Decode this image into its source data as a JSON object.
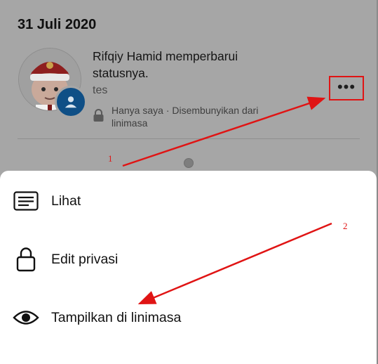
{
  "date_heading": "31 Juli 2020",
  "post": {
    "title": "Rifqiy Hamid memperbarui statusnya.",
    "text": "tes",
    "privacy": "Hanya saya · Disembunyikan dari linimasa"
  },
  "icons": {
    "more": "more-horizontal-icon",
    "privacy": "lock-icon",
    "profile": "person-icon",
    "view": "document-lines-icon",
    "edit_privacy": "lock-icon",
    "show": "eye-icon"
  },
  "more_dots": "•••",
  "sheet": {
    "items": [
      {
        "label": "Lihat"
      },
      {
        "label": "Edit privasi"
      },
      {
        "label": "Tampilkan di linimasa"
      }
    ]
  },
  "annotations": {
    "num1": "1",
    "num2": "2",
    "color": "#e01414"
  },
  "colors": {
    "overlay_bg": "#a6a6a6",
    "sheet_bg": "#ffffff",
    "badge_blue": "#0f4f86"
  }
}
